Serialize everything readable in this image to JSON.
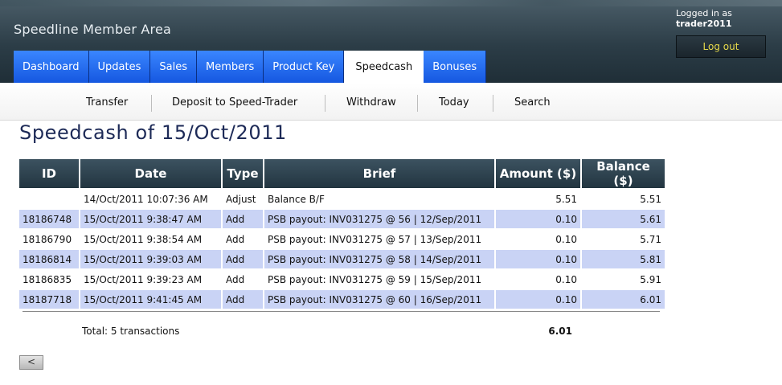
{
  "header": {
    "app_title": "Speedline Member Area",
    "logged_in_text": "Logged in as",
    "username": "trader2011",
    "logout_label": "Log out"
  },
  "main_nav": {
    "tabs": [
      {
        "label": "Dashboard",
        "active": false
      },
      {
        "label": "Updates",
        "active": false
      },
      {
        "label": "Sales",
        "active": false
      },
      {
        "label": "Members",
        "active": false
      },
      {
        "label": "Product Key",
        "active": false
      },
      {
        "label": "Speedcash",
        "active": true
      },
      {
        "label": "Bonuses",
        "active": false
      }
    ]
  },
  "sub_nav": {
    "items": [
      "Transfer",
      "Deposit to Speed-Trader",
      "Withdraw",
      "Today",
      "Search"
    ]
  },
  "page": {
    "title": "Speedcash of 15/Oct/2011"
  },
  "table": {
    "headers": [
      "ID",
      "Date",
      "Type",
      "Brief",
      "Amount ($)",
      "Balance ($)"
    ],
    "rows": [
      {
        "id": "",
        "date": "14/Oct/2011 10:07:36 AM",
        "type": "Adjust",
        "brief": "Balance B/F",
        "amount": "5.51",
        "balance": "5.51"
      },
      {
        "id": "18186748",
        "date": "15/Oct/2011 9:38:47 AM",
        "type": "Add",
        "brief": "PSB payout: INV031275 @ 56 | 12/Sep/2011",
        "amount": "0.10",
        "balance": "5.61"
      },
      {
        "id": "18186790",
        "date": "15/Oct/2011 9:38:54 AM",
        "type": "Add",
        "brief": "PSB payout: INV031275 @ 57 | 13/Sep/2011",
        "amount": "0.10",
        "balance": "5.71"
      },
      {
        "id": "18186814",
        "date": "15/Oct/2011 9:39:03 AM",
        "type": "Add",
        "brief": "PSB payout: INV031275 @ 58 | 14/Sep/2011",
        "amount": "0.10",
        "balance": "5.81"
      },
      {
        "id": "18186835",
        "date": "15/Oct/2011 9:39:23 AM",
        "type": "Add",
        "brief": "PSB payout: INV031275 @ 59 | 15/Sep/2011",
        "amount": "0.10",
        "balance": "5.91"
      },
      {
        "id": "18187718",
        "date": "15/Oct/2011 9:41:45 AM",
        "type": "Add",
        "brief": "PSB payout: INV031275 @ 60 | 16/Sep/2011",
        "amount": "0.10",
        "balance": "6.01"
      }
    ]
  },
  "totals": {
    "label": "Total: 5 transactions",
    "amount": "6.01"
  },
  "back_button": {
    "label": "<"
  },
  "colors": {
    "nav_blue": "#1f66f0",
    "header_dark": "#2c3d47",
    "row_alt": "#c9d3f5",
    "title_navy": "#1d2a57",
    "logout_text": "#e6d94a"
  }
}
